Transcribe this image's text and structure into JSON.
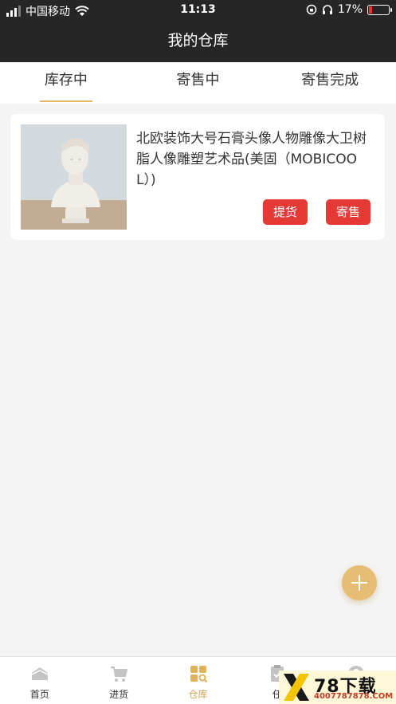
{
  "status_bar": {
    "carrier": "中国移动",
    "time": "11:13",
    "battery_percent": "17%",
    "battery_level": 0.17,
    "battery_color": "#e53935"
  },
  "nav": {
    "title": "我的仓库"
  },
  "tabs": [
    {
      "label": "库存中",
      "active": true
    },
    {
      "label": "寄售中",
      "active": false
    },
    {
      "label": "寄售完成",
      "active": false
    }
  ],
  "product": {
    "title": "北欧装饰大号石膏头像人物雕像大卫树脂人像雕塑艺术品(美固（MOBICOOL）)",
    "pickup_label": "提货",
    "consign_label": "寄售"
  },
  "bottom_nav": [
    {
      "label": "首页",
      "icon": "home-icon"
    },
    {
      "label": "进货",
      "icon": "cart-icon"
    },
    {
      "label": "仓库",
      "icon": "warehouse-icon",
      "active": true
    },
    {
      "label": "任",
      "icon": "task-icon"
    },
    {
      "label": "",
      "icon": "profile-icon"
    }
  ],
  "watermark": {
    "main": "78下载",
    "sub": "4007787878.COM"
  },
  "colors": {
    "accent": "#e8b766",
    "button": "#e53935",
    "header": "#262626",
    "fab": "#e6bd73"
  }
}
